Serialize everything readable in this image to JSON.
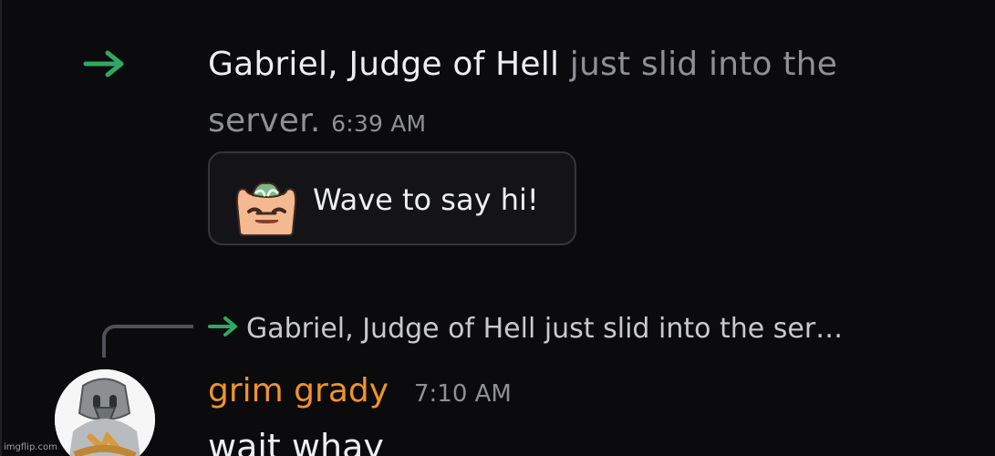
{
  "system_message": {
    "user_name": "Gabriel, Judge of Hell",
    "action_text": " just slid into the server.",
    "timestamp": "6:39 AM",
    "arrow_icon": "arrow-right-icon",
    "accent_color": "#2fa864",
    "wave_button": {
      "label": "Wave to say hi!",
      "sticker_icon": "wumpus-wave-sticker"
    }
  },
  "message": {
    "reply_preview": "Gabriel, Judge of Hell just slid into the ser…",
    "author": "grim grady",
    "author_color": "#f0932b",
    "timestamp": "7:10 AM",
    "content": "wait whay",
    "avatar_icon": "armored-bird-avatar"
  },
  "watermark": "imgflip.com"
}
